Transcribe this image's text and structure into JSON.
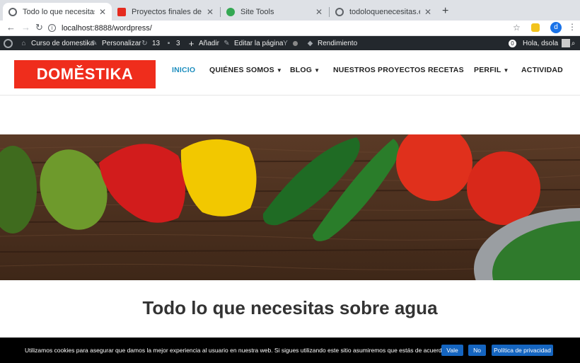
{
  "browser": {
    "tabs": [
      {
        "title": "Todo lo que necesitas sobre agua",
        "favicon_color": "#5f6368"
      },
      {
        "title": "Proyectos finales de \"Creación d",
        "favicon_color": "#e52b1f"
      },
      {
        "title": "Site Tools",
        "favicon_color": "#34a853"
      },
      {
        "title": "todoloquenecesitas.es/installer.p",
        "favicon_color": "#5f6368"
      }
    ],
    "new_tab": "+",
    "url": "localhost:8888/wordpress/",
    "profile_initial": "d"
  },
  "adminbar": {
    "site_name": "Curso de domestika",
    "customize": "Personalizar",
    "updates_count": "13",
    "comments_count": "3",
    "add_new": "Añadir",
    "edit_page": "Editar la página",
    "performance": "Rendimiento",
    "notif_count": "0",
    "greeting": "Hola, dsola"
  },
  "site": {
    "logo_text": "DOMĚSTIKA",
    "nav": [
      {
        "label": "INICIO",
        "active": true,
        "dropdown": false
      },
      {
        "label": "QUIÉNES SOMOS",
        "active": false,
        "dropdown": true
      },
      {
        "label": "BLOG",
        "active": false,
        "dropdown": true
      },
      {
        "label": "NUESTROS PROYECTOS",
        "active": false,
        "dropdown": false
      },
      {
        "label": "RECETAS",
        "active": false,
        "dropdown": false
      },
      {
        "label": "PERFIL",
        "active": false,
        "dropdown": true
      },
      {
        "label": "ACTIVIDAD",
        "active": false,
        "dropdown": false
      }
    ],
    "page_title": "Todo lo que necesitas sobre agua"
  },
  "cookie": {
    "text": "Utilizamos cookies para asegurar que damos la mejor experiencia al usuario en nuestra web. Si sigues utilizando este sitio asumiremos que estás de acuerdo.",
    "accept": "Vale",
    "reject": "No",
    "privacy": "Política de privacidad"
  },
  "colors": {
    "brand": "#ef2d1c",
    "nav_active": "#1f8fbf",
    "adminbar": "#23282d",
    "cookie_button": "#1565c0"
  }
}
